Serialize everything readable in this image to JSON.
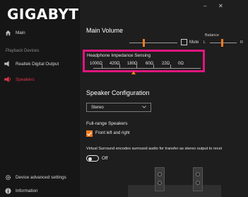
{
  "brand": {
    "logo": "GIGABYTE",
    "trademark": "™"
  },
  "window": {
    "minimize_glyph": "–",
    "close_glyph": "✕"
  },
  "sidebar": {
    "main_label": "Main",
    "section_heading": "Playback Devices",
    "devices": [
      {
        "label": "Realtek Digital Output",
        "icon": "speaker-icon"
      },
      {
        "label": "Speakers",
        "icon": "speaker-icon",
        "active": true
      }
    ],
    "device_settings_label": "Device advanced settings",
    "info_label": "Information"
  },
  "volume": {
    "title": "Main Volume",
    "level": 0.3,
    "mute_label": "Mute",
    "muted": false,
    "balance_label": "Balance",
    "balance_left": "L",
    "balance_right": "R",
    "balance_position": 0.5
  },
  "impedance": {
    "title": "Headphone Impedance Sensing",
    "values": [
      "1000Ω",
      "420Ω",
      "180Ω",
      "60Ω",
      "22Ω",
      "0Ω"
    ],
    "selected": "180Ω"
  },
  "speaker_config": {
    "title": "Speaker Configuration",
    "selected": "Stereo",
    "fullrange_title": "Full-range Speakers",
    "front_label": "Front left and right",
    "front_checked": true,
    "virtual_text": "Virtual Surround encodes surround audio for transfer as stereo output to recei",
    "virtual_state": "Off"
  },
  "colors": {
    "accent": "#f57a20",
    "highlight": "#e0157e",
    "active_nav": "#e0344a",
    "background": "#1e1e1e",
    "sidebar": "#161616"
  }
}
